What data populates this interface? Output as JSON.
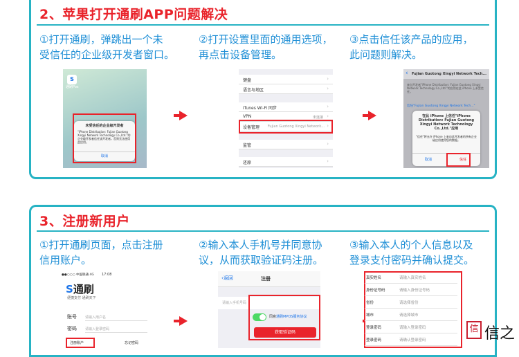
{
  "section1": {
    "title": "2、苹果打开通刷APP问题解决",
    "steps": [
      {
        "line1": "①打开通刷，弹跳出一个未",
        "line2": "受信任的企业级开发者窗口。"
      },
      {
        "line1": "②打开设置里面的通用选项，",
        "line2": "再点击设备管理。"
      },
      {
        "line1": "③点击信任该产品的应用，",
        "line2": "此问题则解决。"
      }
    ],
    "phone1": {
      "app_label": "通刷Pos",
      "dialog_title": "未受信任的企业级开发者",
      "dialog_body": "\"iPhone Distribution: Fujian Guotong Xingyi Network Technology Co.,Ltd.\"的企业级开发者信任该开发者，否则无法使用此应用。",
      "cancel": "取消"
    },
    "phone2": {
      "rows": [
        "键盘",
        "语言与地区",
        "iTunes Wi-Fi 同步",
        "VPN",
        "设备管理",
        "监管",
        "还原"
      ],
      "vpn_value": "未连接",
      "device_value": "Fujian Guotong Xingyi Network..."
    },
    "phone3": {
      "nav_title": "Fujian Guotong Xingyi Network Tech...",
      "bg_text": "来自开发者\"iPhone Distribution: Fujian Guotong Xingyi Network Technology Co.,Ltd.\"的应用在此 iPhone 上未受信任。",
      "trust_link": "信任\"Fujian Guotong Xingyi Network Tech...\"",
      "dialog_title": "在此 iPhone 上信任\"iPhone Distribution: Fujian Guotong Xingyi Network Technology Co.,Ltd.\"应用",
      "dialog_body": "\"信任\"将允许 iPhone 上来自此开发者的所有企业级应用使用您的数据。",
      "cancel": "取消",
      "trust": "信任"
    }
  },
  "section2": {
    "title": "3、注册新用户",
    "steps": [
      {
        "line1": "①打开通刷页面，点击注册",
        "line2": "信用账户。"
      },
      {
        "line1": "②输入本人手机号并同意协",
        "line2": "议，从而获取验证码注册。"
      },
      {
        "line1": "③输入本人的个人信息以及",
        "line2": "登录支付密码并确认提交。"
      }
    ],
    "phone1": {
      "status": "●●○○○ 中国联通 4G",
      "time": "17:08",
      "brand": "通刷",
      "slogan": "便捷支付 通刷天下",
      "account_label": "账号",
      "account_placeholder": "请输入用户名",
      "password_label": "密码",
      "password_placeholder": "请输入登录密码",
      "register": "注册账户",
      "forgot": "忘记密码"
    },
    "phone2": {
      "back": "返回",
      "title": "注册",
      "phone_placeholder": "请输入手机号码",
      "agree_prefix": "同意",
      "agree_link": "通刷MPOS服务协议",
      "get_code": "获取验证码"
    },
    "phone3": {
      "rows": [
        {
          "label": "真实姓名",
          "value": "请输入真实姓名"
        },
        {
          "label": "身份证号码",
          "value": "请输入身份证号码"
        },
        {
          "label": "省份",
          "value": "请选择省份"
        },
        {
          "label": "城市",
          "value": "请选择城市"
        },
        {
          "label": "登录密码",
          "value": "请输入登录密码"
        },
        {
          "label": "登录密码",
          "value": "请确认登录密码"
        }
      ]
    }
  },
  "watermark": {
    "seal": "信",
    "text": "信之"
  },
  "colors": {
    "accent": "#27b3c4",
    "title_red": "#e9232b",
    "step_blue": "#1f8fd6",
    "ios_blue": "#1a73e8",
    "green_switch": "#4cd964"
  }
}
